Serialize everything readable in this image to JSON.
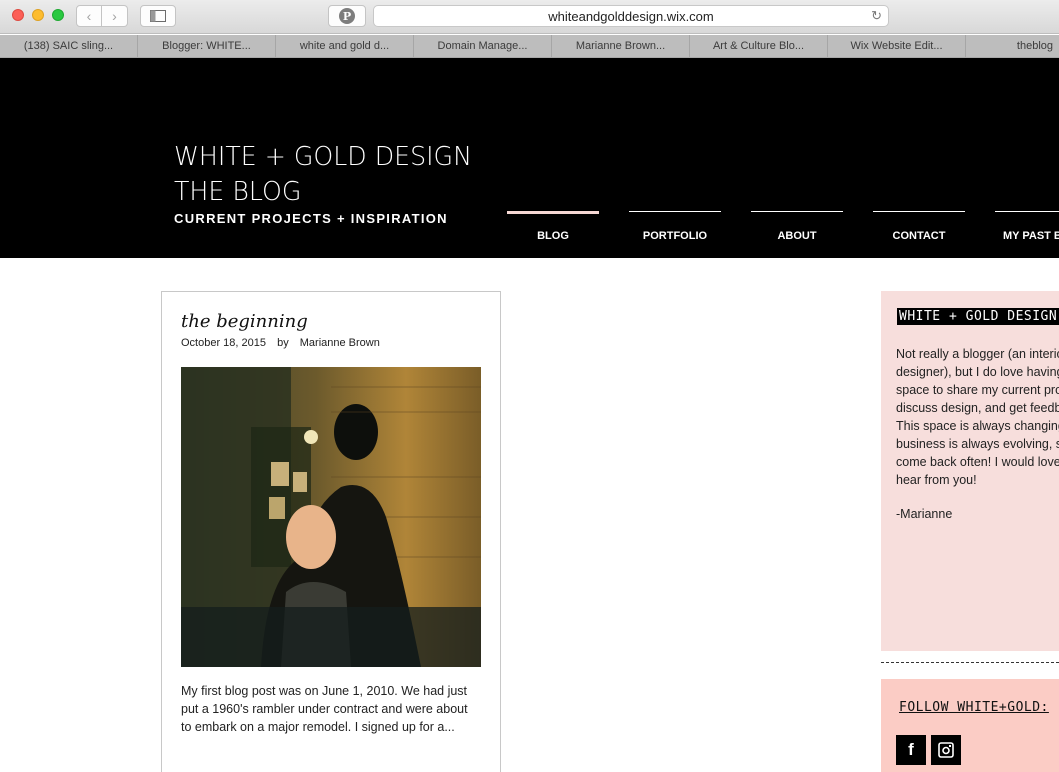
{
  "browser": {
    "url": "whiteandgolddesign.wix.com",
    "tabs": [
      "(138) SAIC sling...",
      "Blogger: WHITE...",
      "white and gold d...",
      "Domain Manage...",
      "Marianne Brown...",
      "Art & Culture Blo...",
      "Wix Website Edit...",
      "theblog"
    ]
  },
  "site": {
    "title_line1": "WHITE + GOLD DESIGN",
    "title_line2": "THE BLOG",
    "subtitle": "CURRENT PROJECTS + INSPIRATION",
    "menu": [
      "BLOG",
      "PORTFOLIO",
      "ABOUT",
      "CONTACT",
      "MY PAST BL"
    ]
  },
  "post": {
    "title": "the beginning",
    "date": "October 18, 2015",
    "by": "by",
    "author": "Marianne Brown",
    "excerpt": "My first blog post was on June 1, 2010. We had just put a 1960's rambler under contract and were about to embark on a major remodel. I signed up for a..."
  },
  "sidebar": {
    "about_heading": "WHITE + GOLD DESIGN:",
    "about_text": "Not really a blogger (an interior designer), but I do love having a space to share my current projects, discuss design, and get feedback. This space is always changing, my business is always evolving, so come back often! I would love to hear from you!",
    "signature": "-Marianne",
    "follow_heading": "FOLLOW WHITE+GOLD:",
    "facebook_glyph": "f"
  },
  "colors": {
    "header_bg": "#000000",
    "about_bg": "#f7dedc",
    "follow_bg": "#fbccc5",
    "active_tab_underline": "#f6d8d4"
  }
}
